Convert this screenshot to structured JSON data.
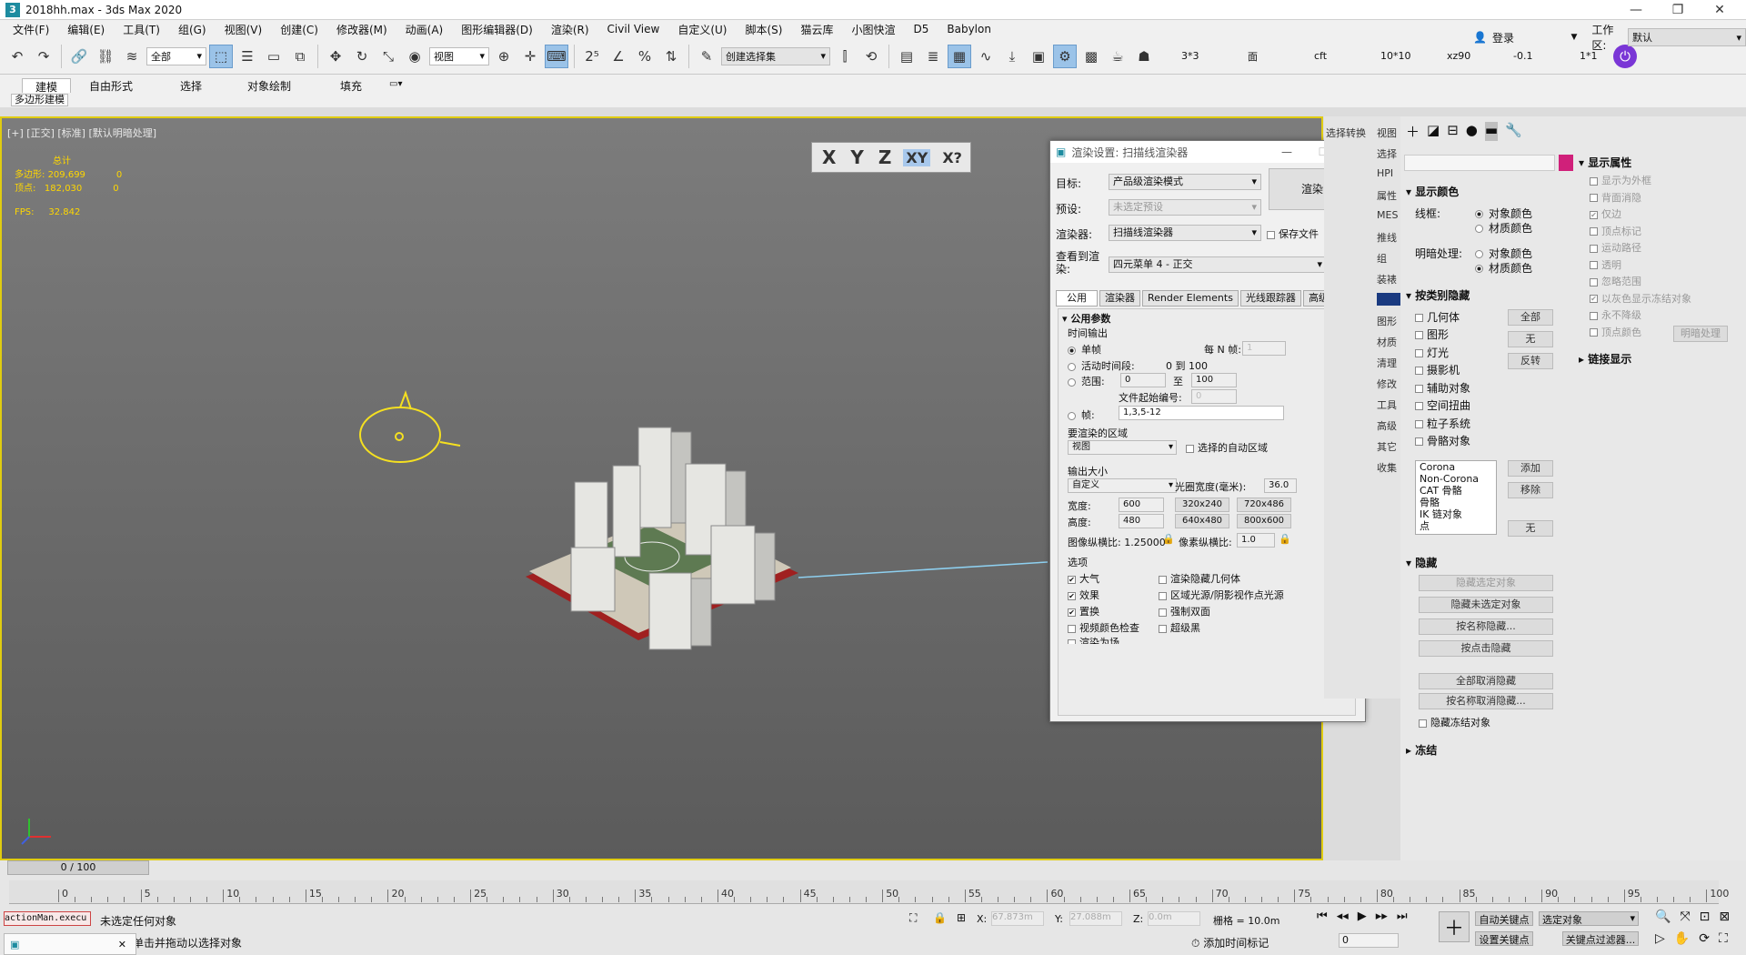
{
  "window": {
    "title": "2018hh.max - 3ds Max 2020",
    "app_icon": "3"
  },
  "menu": [
    "文件(F)",
    "编辑(E)",
    "工具(T)",
    "组(G)",
    "视图(V)",
    "创建(C)",
    "修改器(M)",
    "动画(A)",
    "图形编辑器(D)",
    "渲染(R)",
    "Civil View",
    "自定义(U)",
    "脚本(S)",
    "猫云库",
    "小图快渲",
    "D5",
    "Babylon"
  ],
  "user": {
    "login": "登录",
    "workspace_label": "工作区:",
    "workspace_value": "默认"
  },
  "toolbar": {
    "filter": "全部",
    "refcoord": "视图",
    "selset": "创建选择集",
    "r1": "3*3",
    "r2": "面",
    "r3": "cft",
    "r4": "10*10",
    "r5": "xz90",
    "r6": "-0.1",
    "r7": "1*1"
  },
  "ribbon": {
    "tabs": [
      "建模",
      "自由形式",
      "选择",
      "对象绘制",
      "填充"
    ],
    "sub": "多边形建模"
  },
  "viewport": {
    "label": "[+] [正交] [标准] [默认明暗处理]",
    "stats_header": "总计",
    "poly_label": "多边形:",
    "poly_value": "209,699",
    "poly_sel": "0",
    "vert_label": "顶点:",
    "vert_value": "182,030",
    "vert_sel": "0",
    "fps_label": "FPS:",
    "fps_value": "32.842",
    "axes": [
      "X",
      "Y",
      "Z",
      "XY",
      "X?"
    ]
  },
  "dialog": {
    "title": "渲染设置: 扫描线渲染器",
    "target_label": "目标:",
    "target_value": "产品级渲染模式",
    "preset_label": "预设:",
    "preset_value": "未选定预设",
    "renderer_label": "渲染器:",
    "renderer_value": "扫描线渲染器",
    "save_file": "保存文件",
    "view_label": "查看到渲染:",
    "view_value": "四元菜单 4 - 正交",
    "render_button": "渲染",
    "tabs": [
      "公用",
      "渲染器",
      "Render Elements",
      "光线跟踪器",
      "高级照明"
    ],
    "section": "公用参数",
    "time_output": "时间输出",
    "single": "单帧",
    "every_n": "每 N 帧:",
    "every_n_val": "1",
    "active": "活动时间段:",
    "active_range": "0 到 100",
    "range": "范围:",
    "range_from": "0",
    "range_to_label": "至",
    "range_to": "100",
    "file_start": "文件起始编号:",
    "file_start_val": "0",
    "frames": "帧:",
    "frames_val": "1,3,5-12",
    "area_label": "要渲染的区域",
    "area_value": "视图",
    "auto_region": "选择的自动区域",
    "output_size": "输出大小",
    "size_preset": "自定义",
    "aperture_label": "光圈宽度(毫米):",
    "aperture_value": "36.0",
    "width_label": "宽度:",
    "width_value": "600",
    "height_label": "高度:",
    "height_value": "480",
    "sizes": [
      "320x240",
      "720x486",
      "640x480",
      "800x600"
    ],
    "image_aspect": "图像纵横比: 1.25000",
    "pixel_aspect": "像素纵横比:",
    "pixel_aspect_val": "1.0",
    "options": "选项",
    "opts_left": [
      "大气",
      "效果",
      "置换",
      "视频颜色检查",
      "渲染为场"
    ],
    "opts_left_checked": [
      true,
      true,
      true,
      false,
      false
    ],
    "opts_right": [
      "渲染隐藏几何体",
      "区域光源/阴影视作点光源",
      "强制双面",
      "超级黑"
    ]
  },
  "strip": [
    "选择转换",
    "视图",
    "选择",
    "HPI",
    "属性",
    "MES",
    "推线",
    "组",
    "装裱",
    "图形",
    "材质",
    "清理",
    "修改",
    "工具",
    "高级",
    "其它",
    "收集"
  ],
  "cmd": {
    "display_props": "显示属性",
    "dp_items": [
      "显示为外框",
      "背面消隐",
      "仅边",
      "顶点标记",
      "运动路径",
      "透明",
      "忽略范围",
      "以灰色显示冻结对象",
      "永不降级",
      "顶点颜色"
    ],
    "shading_btn": "明暗处理",
    "link_display": "链接显示",
    "display_color": "显示颜色",
    "wire": "线框:",
    "obj_color": "对象颜色",
    "mat_color": "材质颜色",
    "shaded": "明暗处理:",
    "hide_by_cat": "按类别隐藏",
    "cats": [
      "几何体",
      "图形",
      "灯光",
      "摄影机",
      "辅助对象",
      "空间扭曲",
      "粒子系统",
      "骨骼对象"
    ],
    "all": "全部",
    "none": "无",
    "invert": "反转",
    "list": [
      "Corona",
      "Non-Corona",
      "CAT 骨骼",
      "骨骼",
      "IK 链对象",
      "点"
    ],
    "add": "添加",
    "remove": "移除",
    "none2": "无",
    "hide": "隐藏",
    "hide_btns": [
      "隐藏选定对象",
      "隐藏未选定对象",
      "按名称隐藏...",
      "按点击隐藏",
      "全部取消隐藏",
      "按名称取消隐藏...",
      "隐藏冻结对象"
    ],
    "freeze": "冻结"
  },
  "timeline": {
    "counter": "0 / 100",
    "labels": [
      "0",
      "5",
      "10",
      "15",
      "20",
      "25",
      "30",
      "35",
      "40",
      "45",
      "50",
      "55",
      "60",
      "65",
      "70",
      "75",
      "80",
      "85",
      "90",
      "95",
      "100"
    ]
  },
  "status": {
    "listener": "actionMan.execu",
    "none_sel": "未选定任何对象",
    "hint": "单击并拖动以选择对象",
    "x": "67.873m",
    "y": "27.088m",
    "z": "0.0m",
    "grid": "栅格 = 10.0m",
    "add_tag": "添加时间标记",
    "auto_key": "自动关键点",
    "set_key": "设置关键点",
    "sel_obj": "选定对象",
    "key_filter": "关键点过滤器...",
    "frame": "0"
  }
}
